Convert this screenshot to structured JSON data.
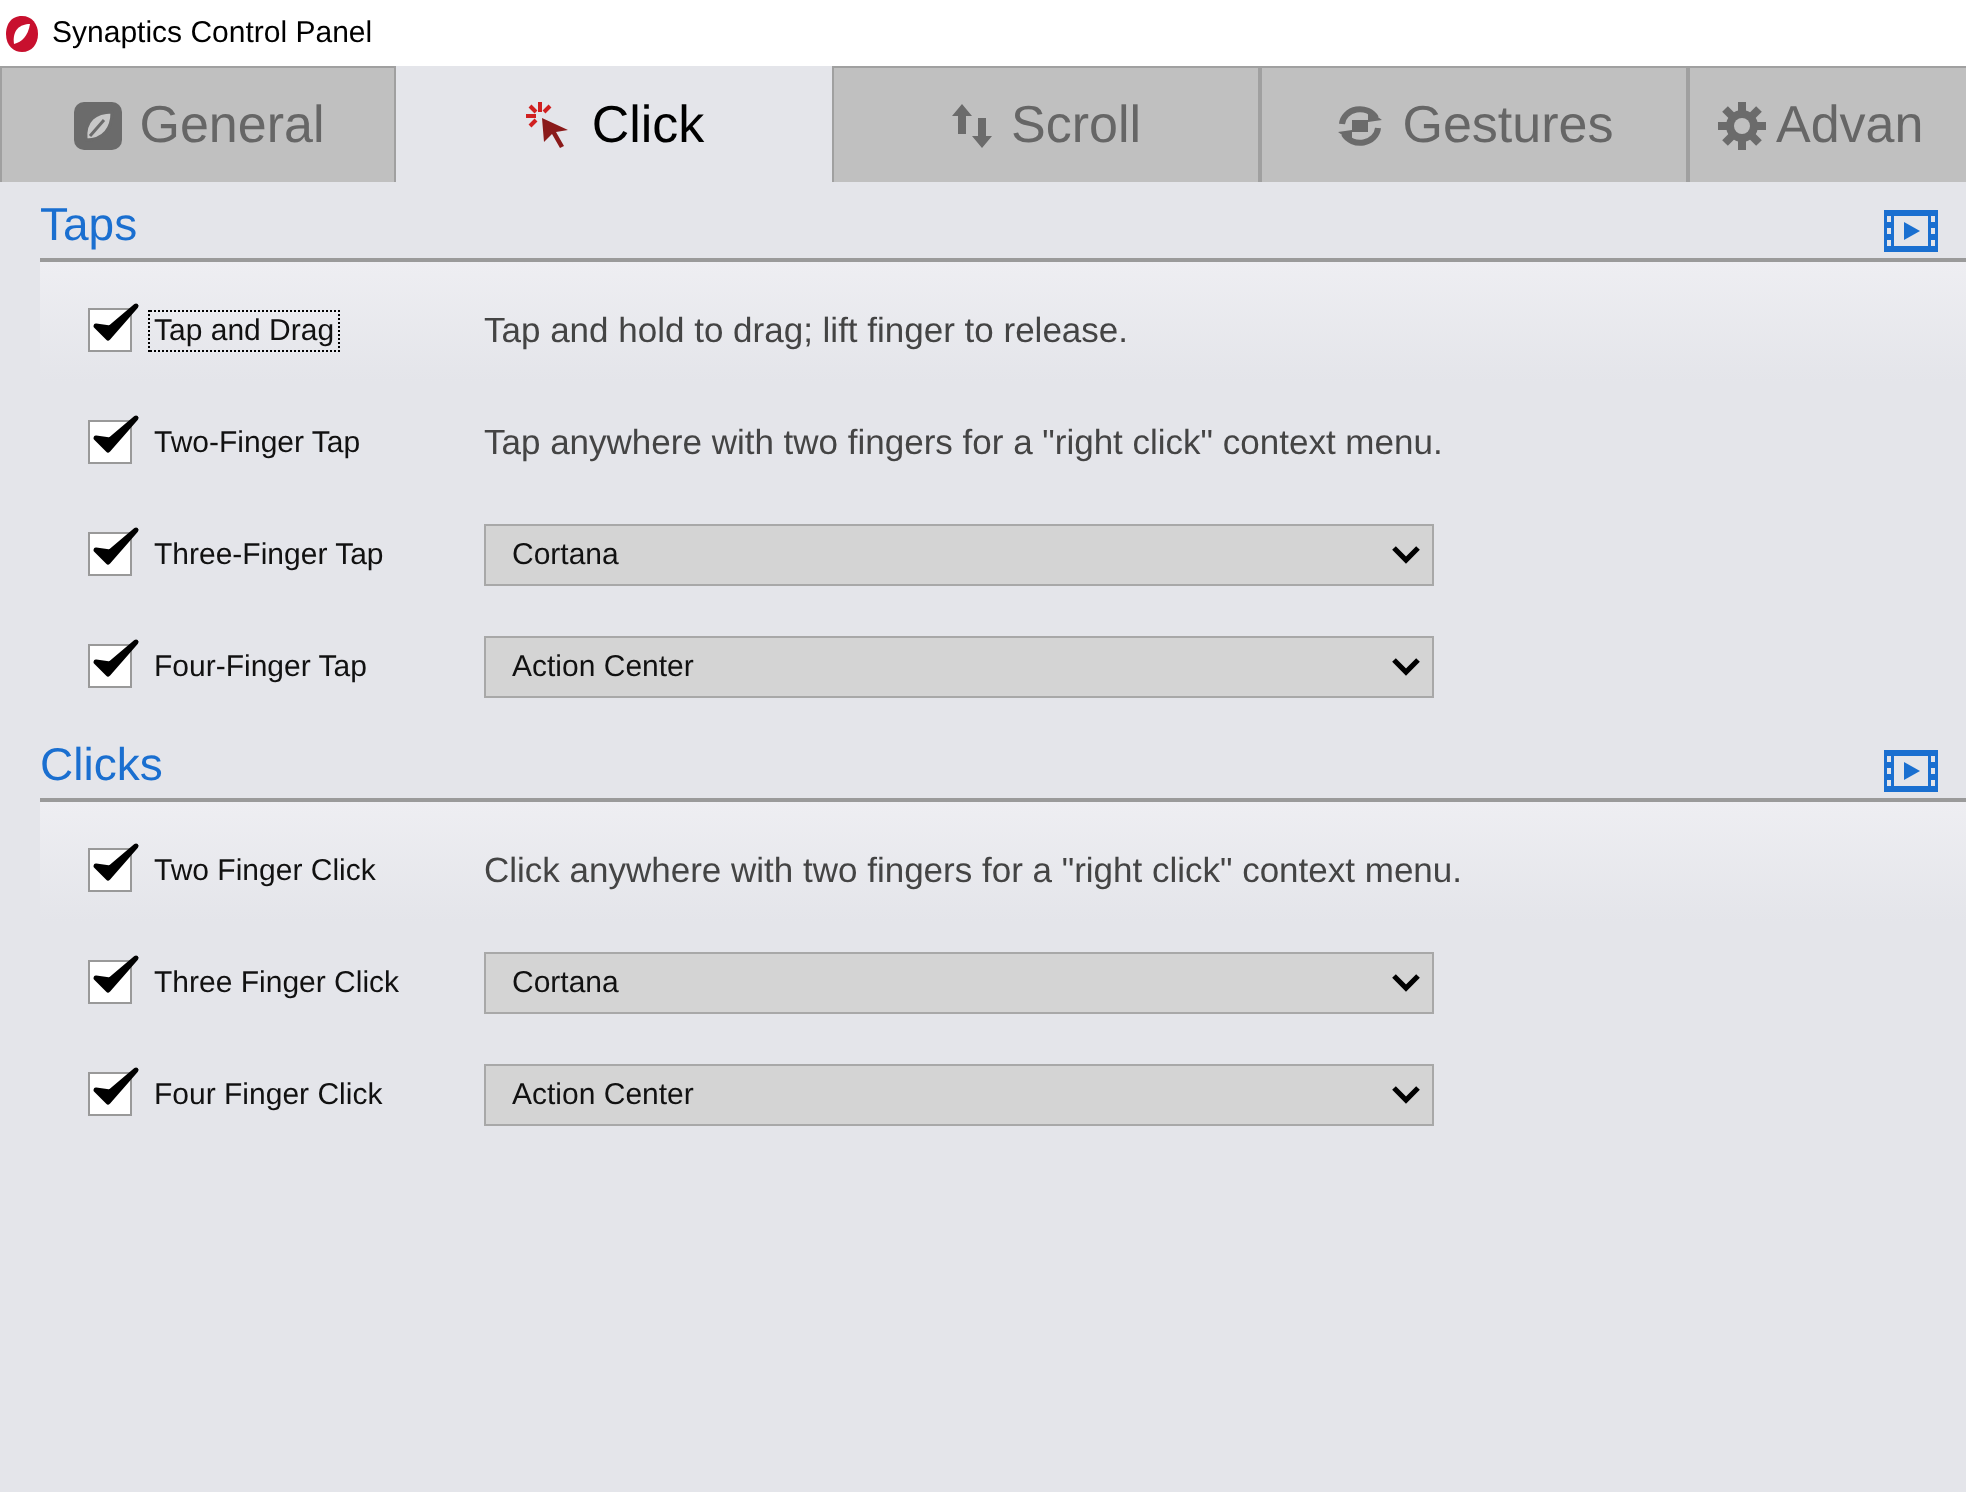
{
  "window": {
    "title": "Synaptics Control Panel"
  },
  "tabs": [
    {
      "label": "General",
      "selected": false
    },
    {
      "label": "Click",
      "selected": true
    },
    {
      "label": "Scroll",
      "selected": false
    },
    {
      "label": "Gestures",
      "selected": false
    },
    {
      "label": "Advan",
      "selected": false
    }
  ],
  "sections": [
    {
      "title": "Taps",
      "rows": [
        {
          "kind": "description",
          "label": "Tap and Drag",
          "checked": true,
          "focused": true,
          "text": "Tap and hold to drag; lift finger to release."
        },
        {
          "kind": "description",
          "label": "Two-Finger Tap",
          "checked": true,
          "focused": false,
          "text": "Tap anywhere with two fingers for a \"right click\" context menu."
        },
        {
          "kind": "dropdown",
          "label": "Three-Finger Tap",
          "checked": true,
          "focused": false,
          "value": "Cortana"
        },
        {
          "kind": "dropdown",
          "label": "Four-Finger Tap",
          "checked": true,
          "focused": false,
          "value": "Action Center"
        }
      ]
    },
    {
      "title": "Clicks",
      "rows": [
        {
          "kind": "description",
          "label": "Two Finger Click",
          "checked": true,
          "focused": false,
          "text": "Click anywhere with two fingers for a \"right click\" context menu."
        },
        {
          "kind": "dropdown",
          "label": "Three Finger Click",
          "checked": true,
          "focused": false,
          "value": "Cortana"
        },
        {
          "kind": "dropdown",
          "label": "Four Finger Click",
          "checked": true,
          "focused": false,
          "value": "Action Center"
        }
      ]
    }
  ]
}
